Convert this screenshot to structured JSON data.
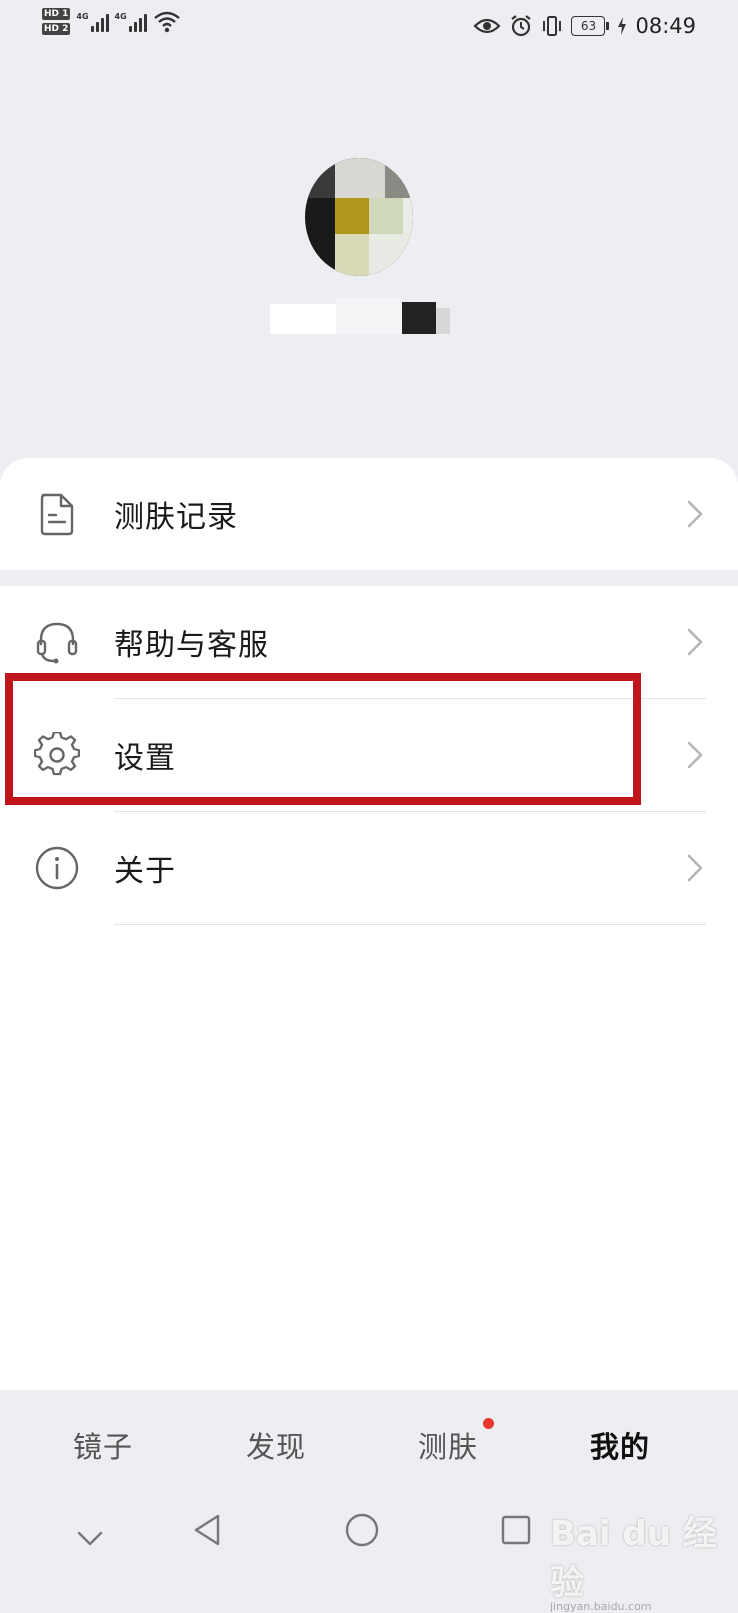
{
  "status_bar": {
    "sim1": "HD 1",
    "sim2": "HD 2",
    "net1": "4G",
    "net2": "4G",
    "battery": "63",
    "time": "08:49"
  },
  "menu": {
    "records": "测肤记录",
    "help": "帮助与客服",
    "settings": "设置",
    "about": "关于"
  },
  "tabs": {
    "mirror": "镜子",
    "discover": "发现",
    "skin_test": "测肤",
    "mine": "我的",
    "active": "mine",
    "badge_on": "skin_test"
  },
  "watermark": {
    "brand": "Bai du 经验",
    "site": "jingyan.baidu.com"
  },
  "colors": {
    "highlight_border": "#c0151b",
    "badge_dot": "#e8362a",
    "page_bg": "#eceef1"
  },
  "icons": {
    "records": "document-icon",
    "help": "headset-icon",
    "settings": "gear-icon",
    "about": "info-icon",
    "chevron": "chevron-right-icon"
  }
}
